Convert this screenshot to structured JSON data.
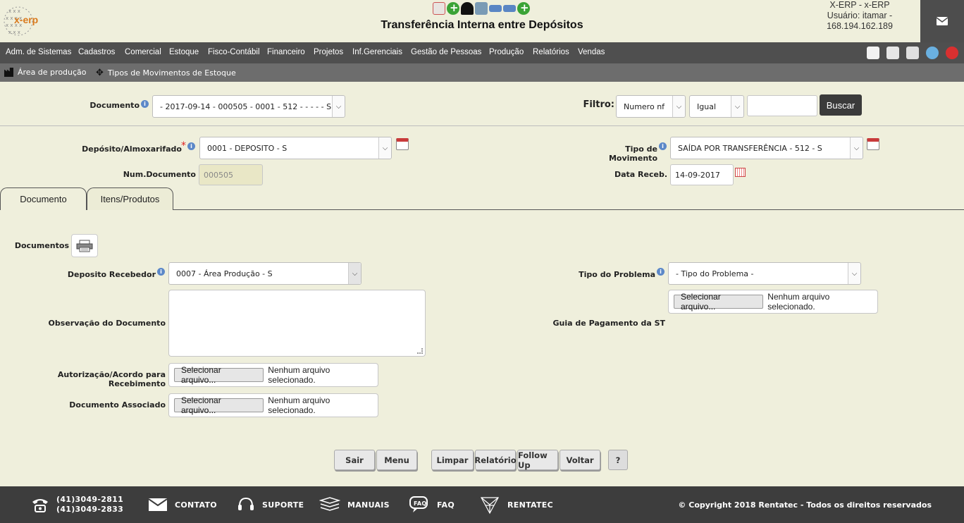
{
  "header": {
    "logo_text": "x-erp",
    "title": "Transferência Interna entre Depósitos",
    "user_line1": "X-ERP - x-ERP",
    "user_line2": "Usuário: itamar -",
    "user_line3": "168.194.162.189"
  },
  "menu": {
    "items": [
      "Adm. de Sistemas",
      "Cadastros",
      "Comercial",
      "Estoque",
      "Fisco-Contábil",
      "Financeiro",
      "Projetos",
      "Inf.Gerenciais",
      "Gestão de Pessoas",
      "Produção",
      "Relatórios",
      "Vendas"
    ]
  },
  "breadcrumb": {
    "item1": "Área de produção",
    "item2": "Tipos de Movimentos de Estoque"
  },
  "search": {
    "documento_label": "Documento",
    "documento_value": "- 2017-09-14 - 000505 - 0001 - 512 - - - - - S",
    "filtro_label": "Filtro:",
    "filtro_field": "Numero nf",
    "filtro_op": "Igual",
    "filtro_value": "",
    "buscar_label": "Buscar"
  },
  "form": {
    "deposito_label": "Depósito/Almoxarifado",
    "deposito_value": "0001 - DEPOSITO - S",
    "tipo_mov_label": "Tipo de Movimento",
    "tipo_mov_value": "SAÍDA POR TRANSFERÊNCIA - 512 - S",
    "num_doc_label": "Num.Documento",
    "num_doc_value": "000505",
    "data_receb_label": "Data Receb.",
    "data_receb_value": "14-09-2017"
  },
  "tabs": [
    "Documento",
    "Itens/Produtos"
  ],
  "documento_tab": {
    "documentos_label": "Documentos",
    "dep_receb_label": "Deposito Recebedor",
    "dep_receb_value": "0007 - Área Produção - S",
    "tipo_problema_label": "Tipo do Problema",
    "tipo_problema_value": "- Tipo do Problema -",
    "obs_label": "Observação do Documento",
    "guia_label": "Guia de Pagamento da ST",
    "autorizacao_label": "Autorização/Acordo para Recebimento",
    "doc_assoc_label": "Documento Associado",
    "file_button": "Selecionar arquivo...",
    "file_none": "Nenhum arquivo selecionado."
  },
  "actions": {
    "sair": "Sair",
    "menu": "Menu",
    "limpar": "Limpar",
    "relatorio": "Relatório",
    "follow_up": "Follow Up",
    "voltar": "Voltar",
    "help": "?"
  },
  "footer": {
    "phone1": "(41)3049-2811",
    "phone2": "(41)3049-2833",
    "contato": "CONTATO",
    "suporte": "SUPORTE",
    "manuais": "MANUAIS",
    "faq": "FAQ",
    "rentatec": "RENTATEC",
    "copyright": "© Copyright 2018 Rentatec - Todos os direitos reservados"
  },
  "icons": [
    "globe-logo-icon",
    "presentation-icon",
    "add-icon",
    "users-icon",
    "devices-icon",
    "card-icon",
    "card-icon",
    "add-icon",
    "mail-icon",
    "home-icon",
    "document-icon",
    "list-icon",
    "world-icon",
    "power-icon",
    "factory-icon",
    "move-icon",
    "calendar-icon",
    "printer-icon",
    "phone-icon",
    "envelope-icon",
    "headset-icon",
    "books-icon",
    "faq-icon",
    "network-icon"
  ]
}
